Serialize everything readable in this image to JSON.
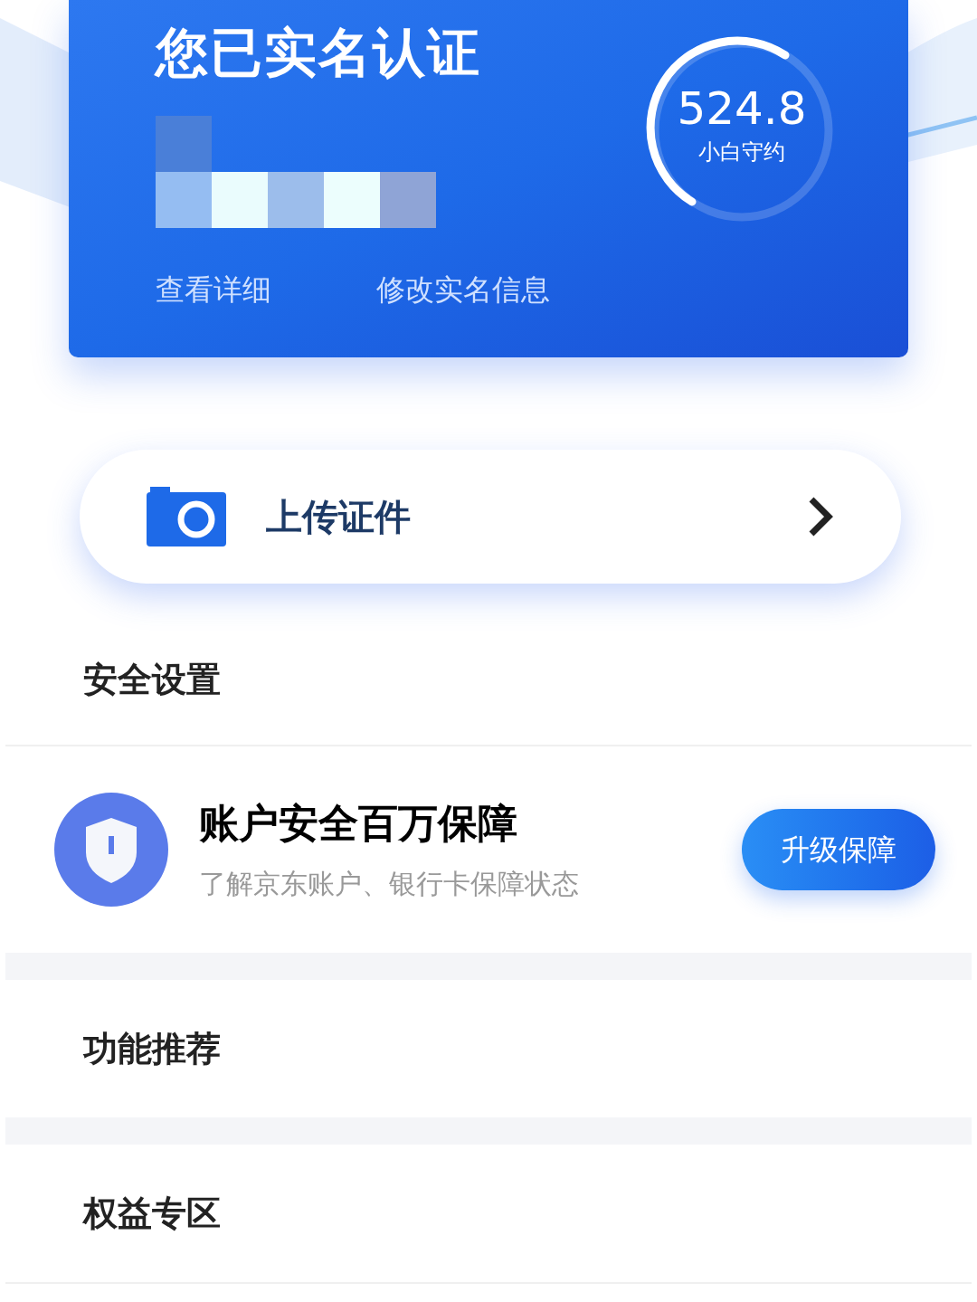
{
  "identity_card": {
    "title": "您已实名认证",
    "score": {
      "value": "524.8",
      "label": "小白守约"
    },
    "links": [
      "查看详细",
      "修改实名信息"
    ]
  },
  "upload": {
    "label": "上传证件"
  },
  "security": {
    "heading": "安全设置",
    "title": "账户安全百万保障",
    "subtitle": "了解京东账户、银行卡保障状态",
    "button": "升级保障"
  },
  "sections": [
    {
      "heading": "功能推荐"
    },
    {
      "heading": "权益专区"
    }
  ]
}
